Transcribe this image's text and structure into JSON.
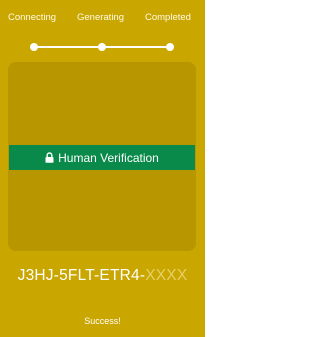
{
  "steps": {
    "items": [
      {
        "label": "Connecting"
      },
      {
        "label": "Generating"
      },
      {
        "label": "Completed"
      }
    ]
  },
  "panel": {
    "button_label": "Human Verification",
    "button_icon": "lock-icon"
  },
  "code": {
    "visible_part": "J3HJ-5FLT-ETR4-",
    "masked_part": "XXXX"
  },
  "status": {
    "text": "Success!"
  },
  "colors": {
    "background": "#c9a600",
    "panel": "#b79600",
    "button": "#0a8a4a",
    "masked_text": "#e6cf6a"
  }
}
